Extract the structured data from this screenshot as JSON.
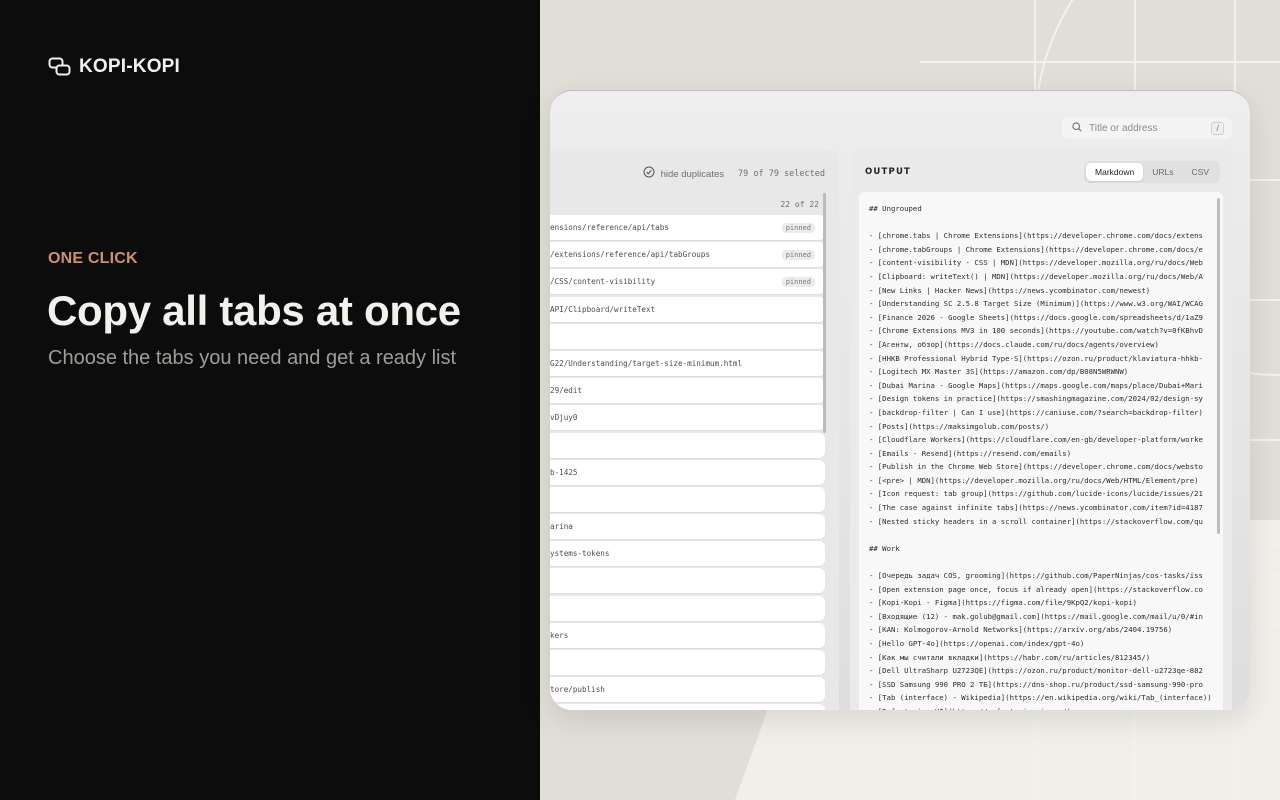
{
  "brand": {
    "name": "KOPI-KOPI",
    "icon": "copy-icon"
  },
  "hero": {
    "kicker": "ONE CLICK",
    "headline": "Copy all tabs at once",
    "subline": "Choose the tabs you need and get a ready list"
  },
  "colors": {
    "accent": "#d0906b",
    "dark": "#0c0c0c",
    "backdrop": "#e1ded7"
  },
  "search": {
    "placeholder": "Title or address",
    "shortcut": "/"
  },
  "tabs_panel": {
    "hide_duplicates": "hide duplicates",
    "selected": "79 of 79 selected",
    "group_count": "22 of 22",
    "rows": [
      {
        "url": "ensions/reference/api/tabs",
        "pinned": "pinned"
      },
      {
        "url": "/extensions/reference/api/tabGroups",
        "pinned": "pinned"
      },
      {
        "url": "/CSS/content-visibility",
        "pinned": "pinned"
      },
      {
        "url": "API/Clipboard/writeText",
        "pinned": ""
      },
      {
        "url": "",
        "pinned": ""
      },
      {
        "url": "G22/Understanding/target-size-minimum.html",
        "pinned": ""
      },
      {
        "url": "29/edit",
        "pinned": ""
      },
      {
        "url": "vDjuy0",
        "pinned": ""
      },
      {
        "url": "",
        "pinned": ""
      },
      {
        "url": "b-1425",
        "pinned": ""
      },
      {
        "url": "",
        "pinned": ""
      },
      {
        "url": "arina",
        "pinned": ""
      },
      {
        "url": "ystems-tokens",
        "pinned": ""
      },
      {
        "url": "",
        "pinned": ""
      },
      {
        "url": "",
        "pinned": ""
      },
      {
        "url": "kers",
        "pinned": ""
      },
      {
        "url": "",
        "pinned": ""
      },
      {
        "url": "tore/publish",
        "pinned": ""
      },
      {
        "url": "",
        "pinned": ""
      }
    ]
  },
  "output": {
    "title": "OUTPUT",
    "formats": [
      "Markdown",
      "URLs",
      "CSV"
    ],
    "active_format": "Markdown",
    "lines": [
      "## Ungrouped",
      "",
      "- [chrome.tabs | Chrome Extensions](https://developer.chrome.com/docs/extens",
      "- [chrome.tabGroups | Chrome Extensions](https://developer.chrome.com/docs/e",
      "- [content-visibility - CSS | MDN](https://developer.mozilla.org/ru/docs/Web",
      "- [Clipboard: writeText() | MDN](https://developer.mozilla.org/ru/docs/Web/A",
      "- [New Links | Hacker News](https://news.ycombinator.com/newest)",
      "- [Understanding SC 2.5.8 Target Size (Minimum)](https://www.w3.org/WAI/WCAG",
      "- [Finance 2026 - Google Sheets](https://docs.google.com/spreadsheets/d/1aZ9",
      "- [Chrome Extensions MV3 in 100 seconds](https://youtube.com/watch?v=0fKBhvD",
      "- [Агенты, обзор](https://docs.claude.com/ru/docs/agents/overview)",
      "- [HHKB Professional Hybrid Type-S](https://ozon.ru/product/klaviatura-hhkb-",
      "- [Logitech MX Master 3S](https://amazon.com/dp/B08N5WRWNW)",
      "- [Dubai Marina - Google Maps](https://maps.google.com/maps/place/Dubai+Mari",
      "- [Design tokens in practice](https://smashingmagazine.com/2024/02/design-sy",
      "- [backdrop-filter | Can I use](https://caniuse.com/?search=backdrop-filter)",
      "- [Posts](https://maksimgolub.com/posts/)",
      "- [Cloudflare Workers](https://cloudflare.com/en-gb/developer-platform/worke",
      "- [Emails - Resend](https://resend.com/emails)",
      "- [Publish in the Chrome Web Store](https://developer.chrome.com/docs/websto",
      "- [<pre> | MDN](https://developer.mozilla.org/ru/docs/Web/HTML/Element/pre)",
      "- [Icon request: tab group](https://github.com/lucide-icons/lucide/issues/21",
      "- [The case against infinite tabs](https://news.ycombinator.com/item?id=4187",
      "- [Nested sticky headers in a scroll container](https://stackoverflow.com/qu",
      "",
      "## Work",
      "",
      "- [Очередь задач COS, grooming](https://github.com/PaperNinjas/cos-tasks/iss",
      "- [Open extension page once, focus if already open](https://stackoverflow.co",
      "- [Kopi-Kopi - Figma](https://figma.com/file/9KpQ2/kopi-kopi)",
      "- [Входящие (12) - mak.golub@gmail.com](https://mail.google.com/mail/u/0/#in",
      "- [KAN: Kolmogorov-Arnold Networks](https://arxiv.org/abs/2404.19756)",
      "- [Hello GPT-4o](https://openai.com/index/gpt-4o)",
      "- [Как мы считали вкладки](https://habr.com/ru/articles/812345/)",
      "- [Dell UltraSharp U2723QE](https://ozon.ru/product/monitor-dell-u2723qe-882",
      "- [SSD Samsung 990 PRO 2 ТБ](https://dns-shop.ru/product/ssd-samsung-990-pro",
      "- [Tab (interface) - Wikipedia](https://en.wikipedia.org/wiki/Tab_(interface))",
      "- [Refactoring UI](https://refactoringui.com/)"
    ]
  }
}
